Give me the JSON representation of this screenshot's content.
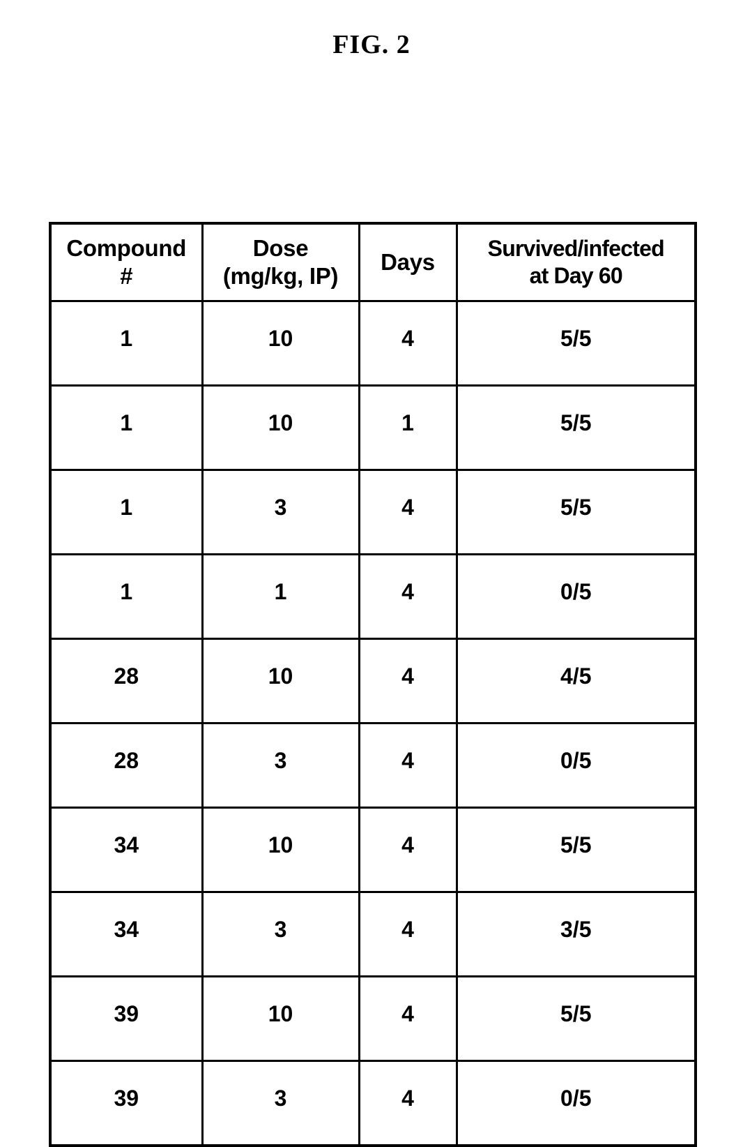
{
  "figure": {
    "title": "FIG. 2"
  },
  "table": {
    "columns": [
      {
        "key": "compound",
        "lines": [
          "Compound",
          "#"
        ]
      },
      {
        "key": "dose",
        "lines": [
          "Dose",
          "(mg/kg, IP)"
        ]
      },
      {
        "key": "days",
        "lines": [
          "Days"
        ]
      },
      {
        "key": "survived",
        "lines": [
          "Survived/infected",
          "at Day 60"
        ]
      }
    ],
    "rows": [
      {
        "compound": "1",
        "dose": "10",
        "days": "4",
        "survived": "5/5"
      },
      {
        "compound": "1",
        "dose": "10",
        "days": "1",
        "survived": "5/5"
      },
      {
        "compound": "1",
        "dose": "3",
        "days": "4",
        "survived": "5/5"
      },
      {
        "compound": "1",
        "dose": "1",
        "days": "4",
        "survived": "0/5"
      },
      {
        "compound": "28",
        "dose": "10",
        "days": "4",
        "survived": "4/5"
      },
      {
        "compound": "28",
        "dose": "3",
        "days": "4",
        "survived": "0/5"
      },
      {
        "compound": "34",
        "dose": "10",
        "days": "4",
        "survived": "5/5"
      },
      {
        "compound": "34",
        "dose": "3",
        "days": "4",
        "survived": "3/5"
      },
      {
        "compound": "39",
        "dose": "10",
        "days": "4",
        "survived": "5/5"
      },
      {
        "compound": "39",
        "dose": "3",
        "days": "4",
        "survived": "0/5"
      }
    ]
  },
  "colors": {
    "ink": "#000000",
    "page": "#ffffff"
  }
}
